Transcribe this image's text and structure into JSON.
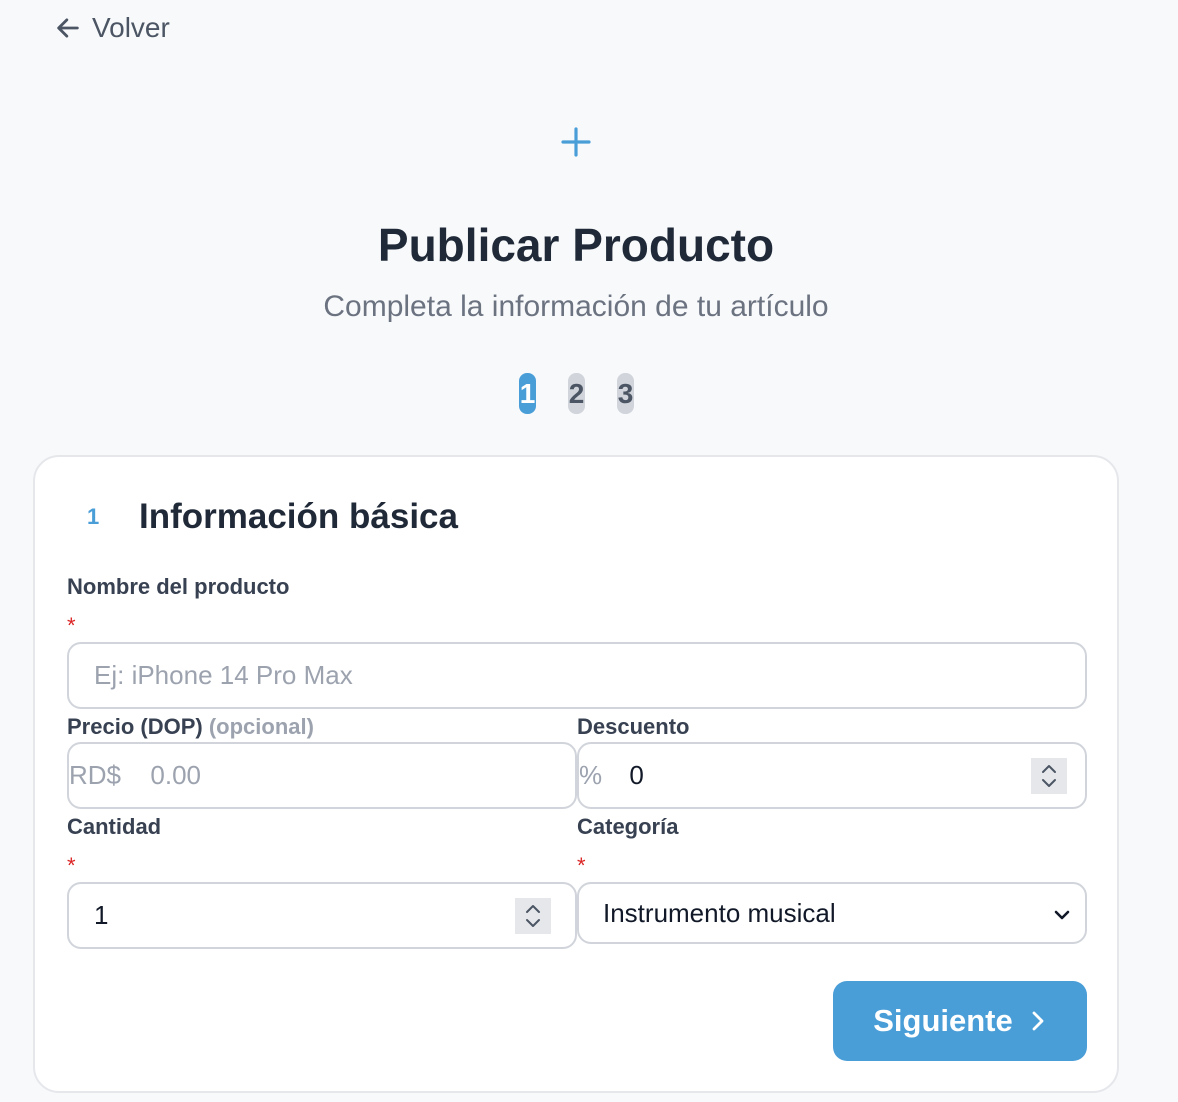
{
  "header": {
    "back_label": "Volver"
  },
  "page": {
    "title": "Publicar Producto",
    "subtitle": "Completa la información de tu artículo"
  },
  "steps": [
    {
      "label": "1",
      "active": true
    },
    {
      "label": "2",
      "active": false
    },
    {
      "label": "3",
      "active": false
    }
  ],
  "section": {
    "number": "1",
    "title": "Información básica"
  },
  "form": {
    "name": {
      "label": "Nombre del producto",
      "required_mark": "*",
      "placeholder": "Ej: iPhone 14 Pro Max",
      "value": ""
    },
    "price": {
      "label": "Precio (DOP)",
      "optional": "(opcional)",
      "prefix": "RD$",
      "placeholder": "0.00",
      "value": ""
    },
    "discount": {
      "label": "Descuento",
      "prefix": "%",
      "value": "0"
    },
    "quantity": {
      "label": "Cantidad",
      "required_mark": "*",
      "value": "1"
    },
    "category": {
      "label": "Categoría",
      "required_mark": "*",
      "selected": "Instrumento musical"
    }
  },
  "actions": {
    "next_label": "Siguiente"
  },
  "colors": {
    "accent": "#4a9ed8",
    "required": "#dc2626",
    "text": "#1f2937",
    "muted": "#6b7280"
  },
  "icons": {
    "back": "arrow-left-icon",
    "add": "plus-icon",
    "next": "chevron-right-icon",
    "select": "chevron-down-icon",
    "spinner": "spinner-arrows-icon"
  }
}
